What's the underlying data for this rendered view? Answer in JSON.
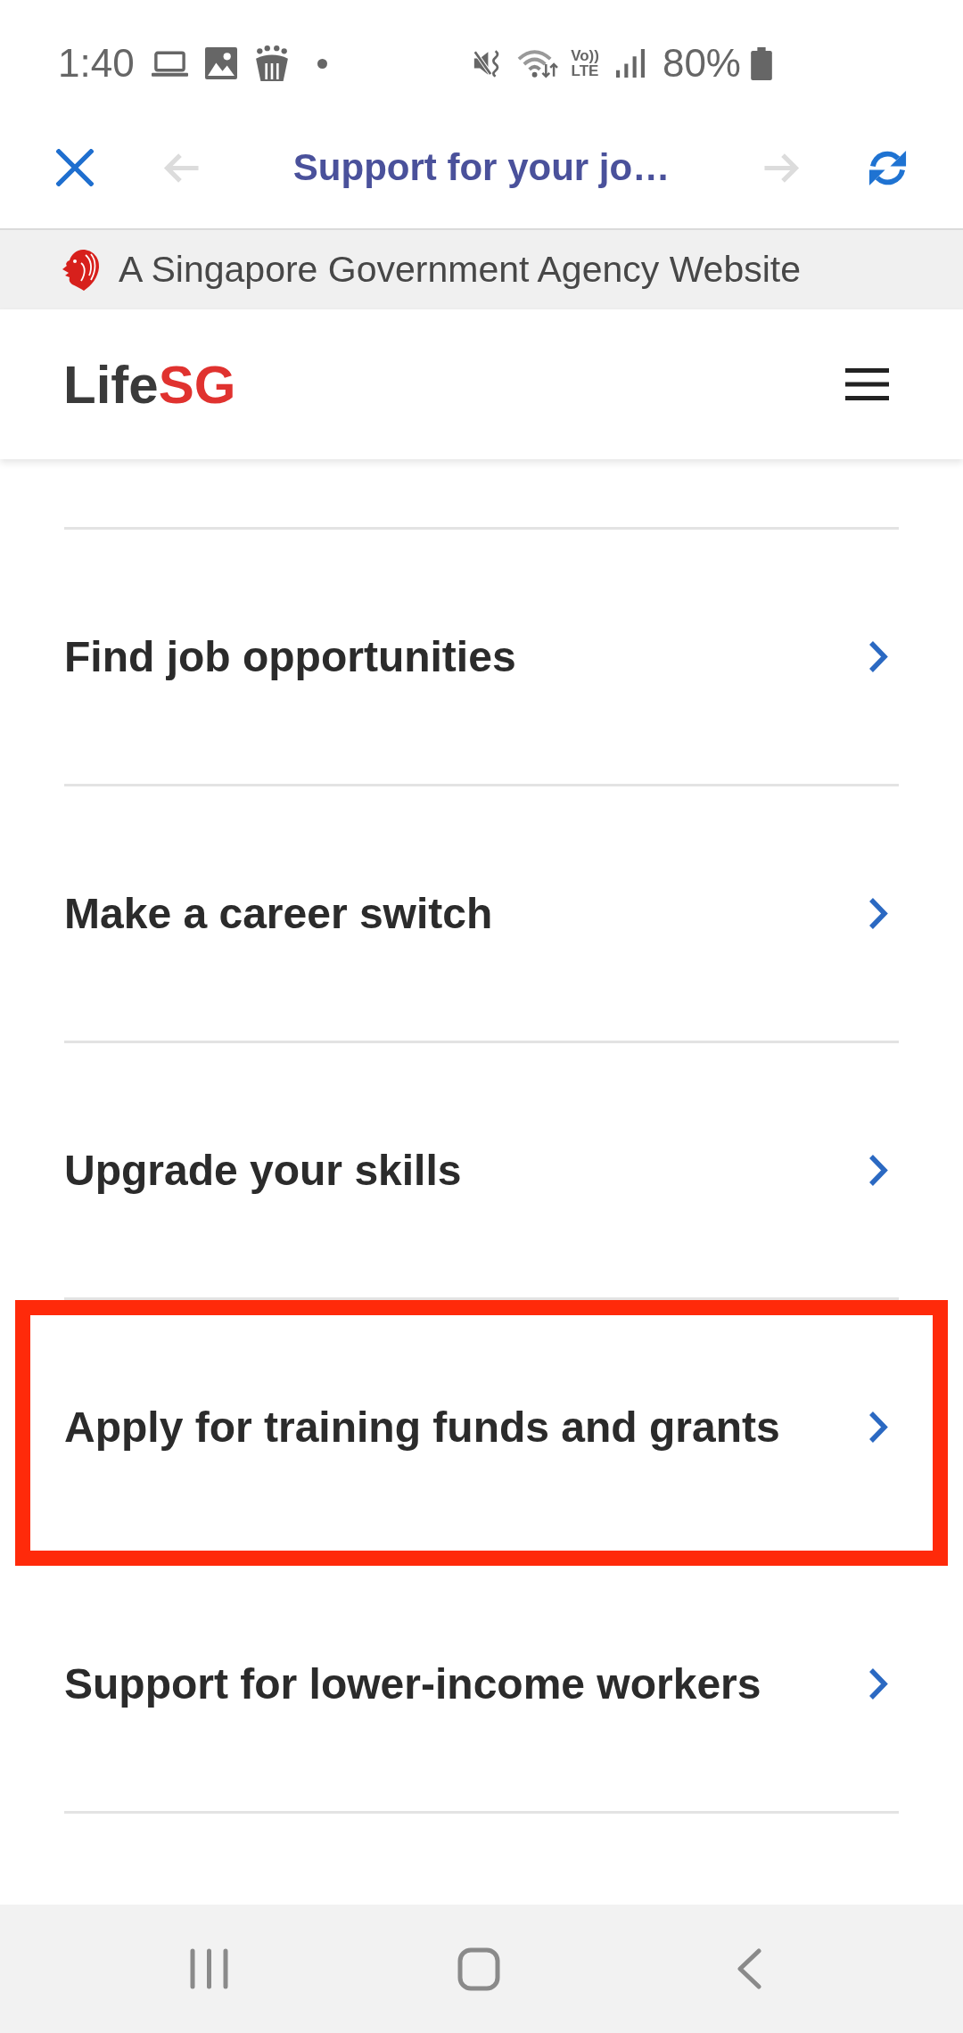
{
  "status_bar": {
    "time": "1:40",
    "network_type": [
      "Vo))",
      "LTE"
    ],
    "battery": "80%"
  },
  "browser_bar": {
    "title": "Support for your jo…",
    "back": {
      "disabled": true
    },
    "forward": {
      "disabled": true
    }
  },
  "gov_banner": {
    "text": "A Singapore Government Agency Website"
  },
  "header": {
    "logo": {
      "primary": "Life",
      "accent": "SG"
    }
  },
  "menu": [
    {
      "label": "Find job opportunities",
      "highlighted": false
    },
    {
      "label": "Make a career switch",
      "highlighted": false
    },
    {
      "label": "Upgrade your skills",
      "highlighted": false
    },
    {
      "label": "Apply for training funds and grants",
      "highlighted": true
    },
    {
      "label": "Support for lower-income workers",
      "highlighted": false
    }
  ]
}
